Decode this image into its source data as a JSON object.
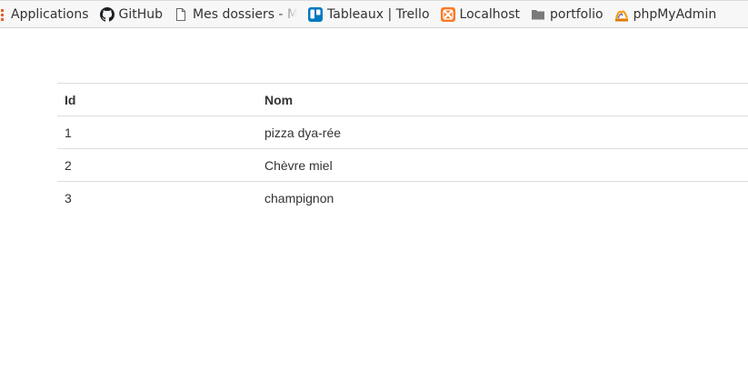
{
  "bookmarks": [
    {
      "label": "Applications",
      "icon": "apps-grid-icon"
    },
    {
      "label": "GitHub",
      "icon": "github-icon"
    },
    {
      "label": "Mes dossiers - My",
      "icon": "page-icon"
    },
    {
      "label": "Tableaux | Trello",
      "icon": "trello-icon"
    },
    {
      "label": "Localhost",
      "icon": "xampp-icon"
    },
    {
      "label": "portfolio",
      "icon": "folder-icon"
    },
    {
      "label": "phpMyAdmin",
      "icon": "phpmyadmin-icon"
    }
  ],
  "table": {
    "headers": [
      "Id",
      "Nom"
    ],
    "rows": [
      [
        "1",
        "pizza dya-rée"
      ],
      [
        "2",
        "Chèvre miel"
      ],
      [
        "3",
        "champignon"
      ]
    ]
  },
  "colors": {
    "trello": "#0079bf",
    "xampp": "#fb7a24",
    "apps_grid": "#e8602c",
    "phpmyadmin": "#f89c0e",
    "border": "#dddddd",
    "text": "#333333"
  }
}
